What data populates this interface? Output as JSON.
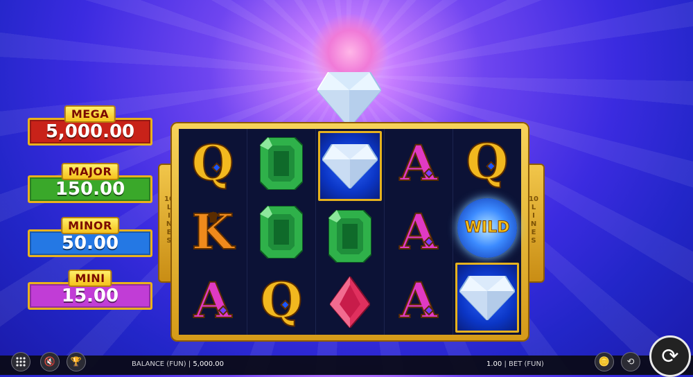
{
  "jackpots": [
    {
      "label": "MEGA",
      "value": "5,000.00",
      "color": "#c82219"
    },
    {
      "label": "MAJOR",
      "value": "150.00",
      "color": "#3aa82a"
    },
    {
      "label": "MINOR",
      "value": "50.00",
      "color": "#2478e4"
    },
    {
      "label": "MINI",
      "value": "15.00",
      "color": "#c13dd6"
    }
  ],
  "lines": {
    "left": [
      "10",
      "L",
      "I",
      "N",
      "E",
      "S"
    ],
    "right": [
      "10",
      "L",
      "I",
      "N",
      "E",
      "S"
    ]
  },
  "reels": [
    [
      "Q",
      "emerald",
      "diamond",
      "A",
      "Q"
    ],
    [
      "K",
      "emerald",
      "emerald",
      "A",
      "wild"
    ],
    [
      "A",
      "Q",
      "ruby",
      "A",
      "diamond"
    ]
  ],
  "wild_label": "WILD",
  "bottom": {
    "balance_label": "BALANCE (FUN)",
    "balance_sep": "|",
    "balance": "5,000.00",
    "bet_value": "1.00",
    "bet_sep": "|",
    "bet_label": "BET (FUN)"
  },
  "icons": {
    "menu": "grid-menu-icon",
    "sound": "mute-icon",
    "trophy": "trophy-icon",
    "coins": "coins-icon",
    "auto": "autoplay-icon",
    "spin": "spin-icon"
  }
}
